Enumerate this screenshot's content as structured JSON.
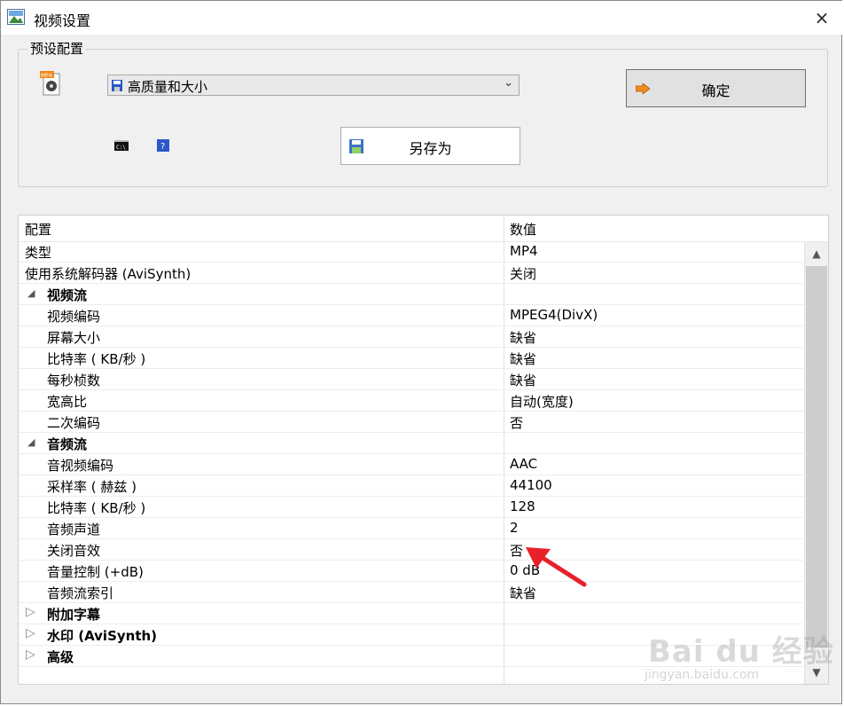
{
  "window": {
    "title": "视频设置",
    "close_label": "×"
  },
  "preset": {
    "group_title": "预设配置",
    "selected": "高质量和大小",
    "ok_label": "确定",
    "save_as_label": "另存为"
  },
  "grid": {
    "col_config": "配置",
    "col_value": "数值",
    "rows": [
      {
        "label": "类型",
        "value": "MP4"
      },
      {
        "label": "使用系统解码器 (AviSynth)",
        "value": "关闭"
      },
      {
        "label": "视频流",
        "value": ""
      },
      {
        "label": "视频编码",
        "value": "MPEG4(DivX)"
      },
      {
        "label": "屏幕大小",
        "value": "缺省"
      },
      {
        "label": "比特率 ( KB/秒 )",
        "value": "缺省"
      },
      {
        "label": "每秒桢数",
        "value": "缺省"
      },
      {
        "label": "宽高比",
        "value": "自动(宽度)"
      },
      {
        "label": "二次编码",
        "value": "否"
      },
      {
        "label": "音频流",
        "value": ""
      },
      {
        "label": "音视频编码",
        "value": "AAC"
      },
      {
        "label": "采样率 ( 赫兹 )",
        "value": "44100"
      },
      {
        "label": "比特率 ( KB/秒 )",
        "value": "128"
      },
      {
        "label": "音频声道",
        "value": "2"
      },
      {
        "label": "关闭音效",
        "value": "否"
      },
      {
        "label": "音量控制 (+dB)",
        "value": "0 dB"
      },
      {
        "label": "音频流索引",
        "value": "缺省"
      },
      {
        "label": "附加字幕",
        "value": ""
      },
      {
        "label": "水印 (AviSynth)",
        "value": ""
      },
      {
        "label": "高级",
        "value": ""
      }
    ]
  },
  "watermark": {
    "brand": "Bai du 经验",
    "url": "jingyan.baidu.com"
  },
  "colors": {
    "accent_orange": "#f08a1c",
    "arrow_red": "#e8202a",
    "help_blue": "#2b58c9"
  },
  "icons": [
    "app-icon",
    "close-icon",
    "mp4-file-icon",
    "floppy-icon",
    "chevron-down-icon",
    "arrow-right-icon",
    "command-prompt-icon",
    "help-icon",
    "expand-icon",
    "collapse-icon"
  ]
}
